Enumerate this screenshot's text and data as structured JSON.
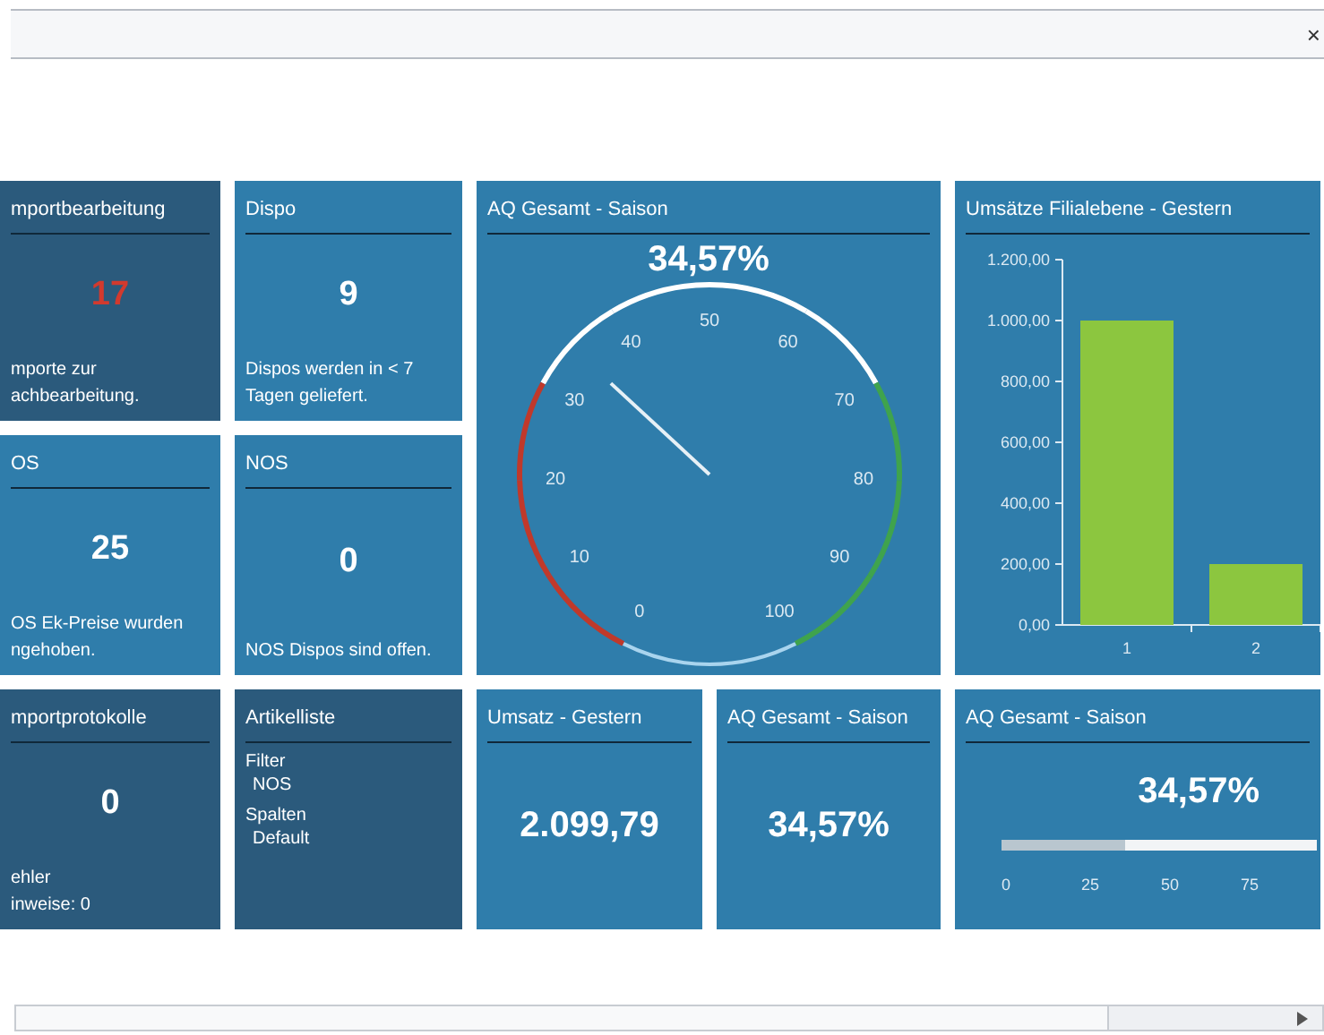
{
  "window": {
    "close": "×"
  },
  "left_tiles": [
    {
      "kind": "kpi",
      "title": "mportbearbeitung",
      "color": "#2b5a7c",
      "value": "17",
      "alert": true,
      "note": [
        "mporte zur",
        "achbearbeitung."
      ]
    },
    {
      "kind": "kpi",
      "title": "Dispo",
      "color": "#2f7dab",
      "value": "9",
      "alert": false,
      "note": [
        "Dispos werden in < 7",
        "Tagen geliefert."
      ]
    },
    {
      "kind": "kpi",
      "title": "OS",
      "color": "#2f7dab",
      "value": "25",
      "alert": false,
      "note": [
        "OS Ek-Preise wurden",
        "ngehoben."
      ]
    },
    {
      "kind": "kpi",
      "title": "NOS",
      "color": "#2f7dab",
      "value": "0",
      "alert": false,
      "note": [
        "NOS Dispos sind offen."
      ]
    },
    {
      "kind": "kpi",
      "title": "mportprotokolle",
      "color": "#2b5a7c",
      "value": "0",
      "alert": false,
      "note": [
        "ehler",
        "inweise: 0"
      ]
    },
    {
      "kind": "list",
      "title": "Artikelliste",
      "color": "#2b5a7c",
      "fields": [
        {
          "label": "Filter",
          "value": "NOS"
        },
        {
          "label": "Spalten",
          "value": "Default"
        }
      ]
    }
  ],
  "top_tiles": [
    {
      "kind": "gauge",
      "title": "AQ Gesamt - Saison",
      "color": "#2f7dab",
      "value": "34,57%",
      "level": 0.3457,
      "scale": [
        {
          "label": "0",
          "color": "#c0392b"
        },
        {
          "label": "10",
          "color": "#c0392b"
        },
        {
          "label": "20",
          "color": "#c0392b"
        },
        {
          "label": "30",
          "color": "#ffffff"
        },
        {
          "label": "40",
          "color": "#ffffff"
        },
        {
          "label": "50",
          "color": "#ffffff"
        },
        {
          "label": "60",
          "color": "#ffffff"
        },
        {
          "label": "70",
          "color": "#3fa34d"
        },
        {
          "label": "80",
          "color": "#3fa34d"
        },
        {
          "label": "90",
          "color": "#3fa34d"
        },
        {
          "label": "100"
        }
      ]
    },
    {
      "kind": "chart",
      "title": "Umsätze Filialebene - Gestern",
      "color": "#2f7dab",
      "chart_data": {
        "type": "bar",
        "categories": [
          "1",
          "2"
        ],
        "series": [
          {
            "color": "#8cc63f",
            "values": [
              1000,
              200
            ]
          }
        ],
        "ylim": [
          0,
          1200
        ],
        "yticks": [
          {
            "value": 0,
            "label": "0,00"
          },
          {
            "value": 200,
            "label": "200,00"
          },
          {
            "value": 400,
            "label": "400,00"
          },
          {
            "value": 600,
            "label": "600,00"
          },
          {
            "value": 800,
            "label": "800,00"
          },
          {
            "value": 1000,
            "label": "1.000,00"
          },
          {
            "value": 1200,
            "label": "1.200,00"
          }
        ]
      }
    }
  ],
  "bottom_tiles": [
    {
      "kind": "big",
      "title": "Umsatz - Gestern",
      "color": "#2f7dab",
      "value": "2.099,79"
    },
    {
      "kind": "big",
      "title": "AQ Gesamt - Saison",
      "color": "#2f7dab",
      "value": "34,57%"
    },
    {
      "kind": "progress",
      "title": "AQ Gesamt - Saison",
      "color": "#2f7dab",
      "value": "34,57%",
      "level": 0.3457,
      "scale_labels": [
        "0",
        "25",
        "50",
        "75"
      ]
    }
  ]
}
